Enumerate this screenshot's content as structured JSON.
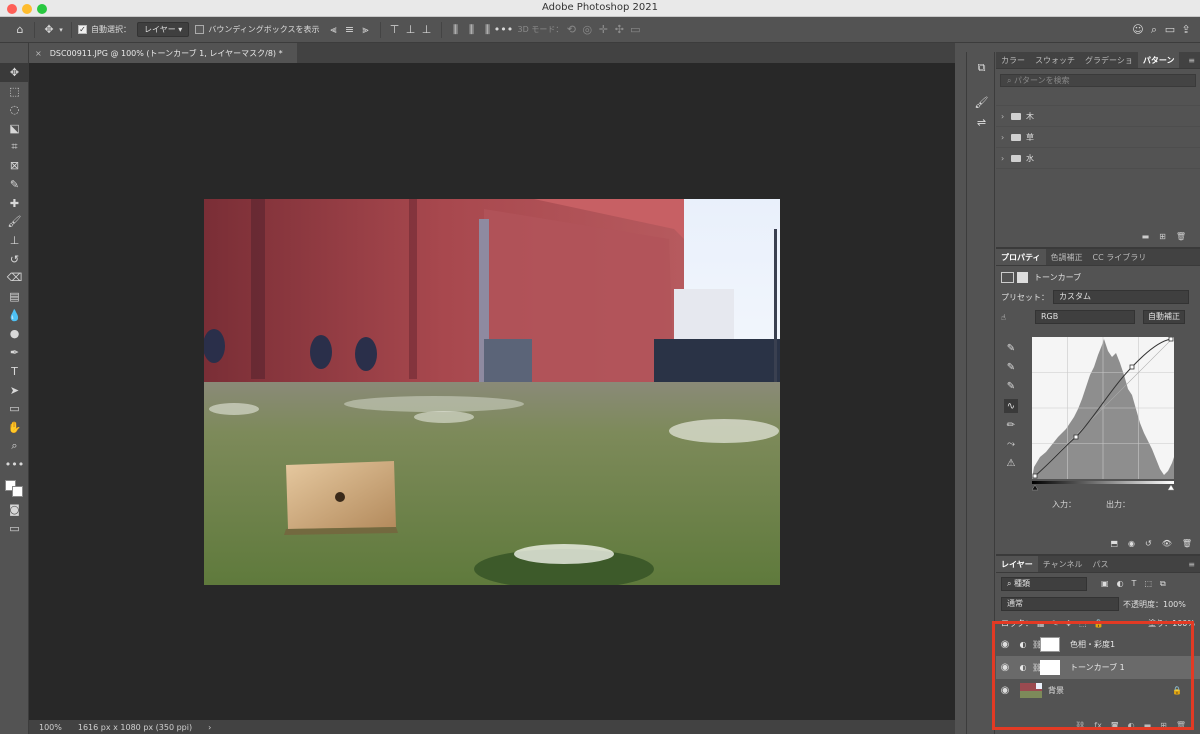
{
  "window": {
    "title": "Adobe Photoshop 2021"
  },
  "options_bar": {
    "auto_select_label": "自動選択：",
    "auto_select_target": "レイヤー",
    "bounding_box_label": "バウンディングボックスを表示",
    "threed_mode_label": "3D モード："
  },
  "document": {
    "tab_title": "DSC00911.JPG @ 100% (トーンカーブ 1, レイヤーマスク/8) *",
    "close_glyph": "×"
  },
  "status": {
    "zoom": "100%",
    "info": "1616 px x 1080 px (350 ppi)",
    "arrow": "›"
  },
  "patterns_panel": {
    "tabs": [
      "カラー",
      "スウォッチ",
      "グラデーショ",
      "パターン"
    ],
    "active_tab": 3,
    "search_placeholder": "パターンを検索",
    "groups": [
      "木",
      "草",
      "水"
    ]
  },
  "properties_panel": {
    "tabs": [
      "プロパティ",
      "色調補正",
      "CC ライブラリ"
    ],
    "active_tab": 0,
    "adjustment_name": "トーンカーブ",
    "preset_label": "プリセット：",
    "preset_value": "カスタム",
    "channel_value": "RGB",
    "auto_button": "自動補正",
    "input_label": "入力：",
    "output_label": "出力："
  },
  "layers_panel": {
    "tabs": [
      "レイヤー",
      "チャンネル",
      "パス"
    ],
    "active_tab": 0,
    "filter_label": "種類",
    "blend_mode": "通常",
    "opacity_label": "不透明度：",
    "opacity_value": "100%",
    "lock_label": "ロック：",
    "fill_label": "塗り：",
    "fill_value": "100%",
    "layers": [
      {
        "name": "色相・彩度1",
        "type": "adjustment"
      },
      {
        "name": "トーンカーブ 1",
        "type": "adjustment",
        "selected": true
      },
      {
        "name": "背景",
        "type": "image"
      }
    ]
  },
  "highlight_color": "#e23a24"
}
